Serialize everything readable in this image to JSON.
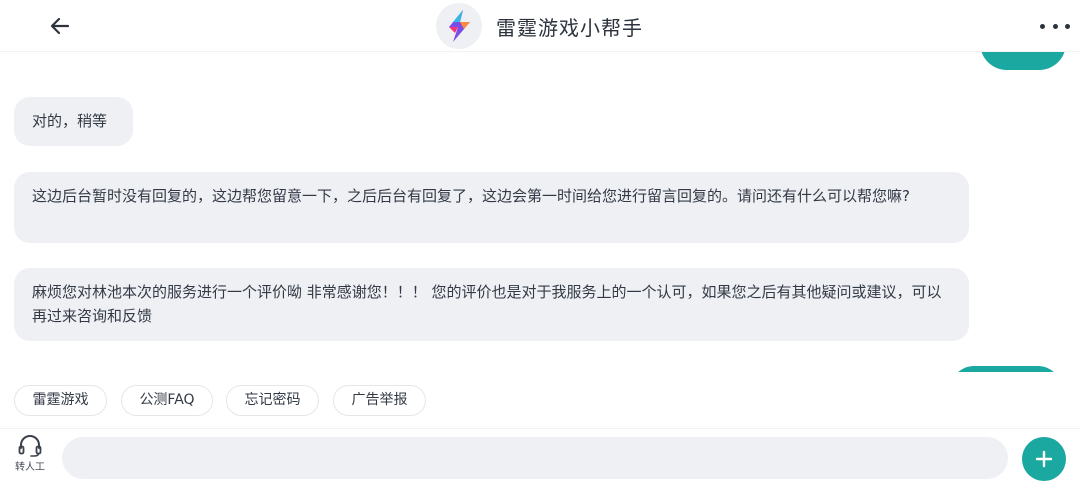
{
  "header": {
    "title": "雷霆游戏小帮手",
    "back_icon": "arrow-left-icon",
    "logo_icon": "lightning-logo-icon",
    "more_icon": "more-dots-icon"
  },
  "messages": [
    {
      "sender": "agent",
      "text": "对的，稍等"
    },
    {
      "sender": "agent",
      "text": "这边后台暂时没有回复的，这边帮您留意一下，之后后台有回复了，这边会第一时间给您进行留言回复的。请问还有什么可以帮您嘛?"
    },
    {
      "sender": "agent",
      "text": "麻烦您对林池本次的服务进行一个评价呦 非常感谢您！！！ 您的评价也是对于我服务上的一个认可，如果您之后有其他疑问或建议，可以再过来咨询和反馈"
    }
  ],
  "quick_replies": [
    "雷霆游戏",
    "公测FAQ",
    "忘记密码",
    "广告举报"
  ],
  "input_bar": {
    "agent_label": "转人工",
    "agent_icon": "headset-icon",
    "input_value": "",
    "input_placeholder": "",
    "send_icon": "plus-icon"
  },
  "colors": {
    "accent": "#1aa8a0",
    "bubble_bg": "#eef0f4",
    "text": "#333a45"
  }
}
